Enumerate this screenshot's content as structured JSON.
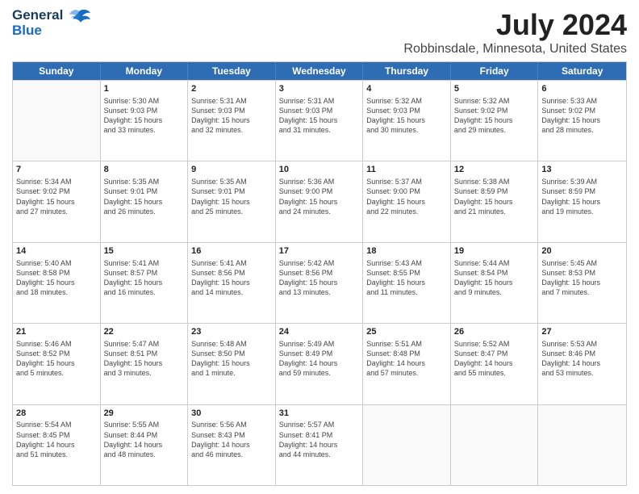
{
  "header": {
    "logo_line1": "General",
    "logo_line2": "Blue",
    "title": "July 2024",
    "location": "Robbinsdale, Minnesota, United States"
  },
  "days_of_week": [
    "Sunday",
    "Monday",
    "Tuesday",
    "Wednesday",
    "Thursday",
    "Friday",
    "Saturday"
  ],
  "weeks": [
    [
      {
        "day": "",
        "empty": true
      },
      {
        "day": "1",
        "sunrise": "Sunrise: 5:30 AM",
        "sunset": "Sunset: 9:03 PM",
        "daylight": "Daylight: 15 hours",
        "daylight2": "and 33 minutes."
      },
      {
        "day": "2",
        "sunrise": "Sunrise: 5:31 AM",
        "sunset": "Sunset: 9:03 PM",
        "daylight": "Daylight: 15 hours",
        "daylight2": "and 32 minutes."
      },
      {
        "day": "3",
        "sunrise": "Sunrise: 5:31 AM",
        "sunset": "Sunset: 9:03 PM",
        "daylight": "Daylight: 15 hours",
        "daylight2": "and 31 minutes."
      },
      {
        "day": "4",
        "sunrise": "Sunrise: 5:32 AM",
        "sunset": "Sunset: 9:03 PM",
        "daylight": "Daylight: 15 hours",
        "daylight2": "and 30 minutes."
      },
      {
        "day": "5",
        "sunrise": "Sunrise: 5:32 AM",
        "sunset": "Sunset: 9:02 PM",
        "daylight": "Daylight: 15 hours",
        "daylight2": "and 29 minutes."
      },
      {
        "day": "6",
        "sunrise": "Sunrise: 5:33 AM",
        "sunset": "Sunset: 9:02 PM",
        "daylight": "Daylight: 15 hours",
        "daylight2": "and 28 minutes."
      }
    ],
    [
      {
        "day": "7",
        "sunrise": "Sunrise: 5:34 AM",
        "sunset": "Sunset: 9:02 PM",
        "daylight": "Daylight: 15 hours",
        "daylight2": "and 27 minutes."
      },
      {
        "day": "8",
        "sunrise": "Sunrise: 5:35 AM",
        "sunset": "Sunset: 9:01 PM",
        "daylight": "Daylight: 15 hours",
        "daylight2": "and 26 minutes."
      },
      {
        "day": "9",
        "sunrise": "Sunrise: 5:35 AM",
        "sunset": "Sunset: 9:01 PM",
        "daylight": "Daylight: 15 hours",
        "daylight2": "and 25 minutes."
      },
      {
        "day": "10",
        "sunrise": "Sunrise: 5:36 AM",
        "sunset": "Sunset: 9:00 PM",
        "daylight": "Daylight: 15 hours",
        "daylight2": "and 24 minutes."
      },
      {
        "day": "11",
        "sunrise": "Sunrise: 5:37 AM",
        "sunset": "Sunset: 9:00 PM",
        "daylight": "Daylight: 15 hours",
        "daylight2": "and 22 minutes."
      },
      {
        "day": "12",
        "sunrise": "Sunrise: 5:38 AM",
        "sunset": "Sunset: 8:59 PM",
        "daylight": "Daylight: 15 hours",
        "daylight2": "and 21 minutes."
      },
      {
        "day": "13",
        "sunrise": "Sunrise: 5:39 AM",
        "sunset": "Sunset: 8:59 PM",
        "daylight": "Daylight: 15 hours",
        "daylight2": "and 19 minutes."
      }
    ],
    [
      {
        "day": "14",
        "sunrise": "Sunrise: 5:40 AM",
        "sunset": "Sunset: 8:58 PM",
        "daylight": "Daylight: 15 hours",
        "daylight2": "and 18 minutes."
      },
      {
        "day": "15",
        "sunrise": "Sunrise: 5:41 AM",
        "sunset": "Sunset: 8:57 PM",
        "daylight": "Daylight: 15 hours",
        "daylight2": "and 16 minutes."
      },
      {
        "day": "16",
        "sunrise": "Sunrise: 5:41 AM",
        "sunset": "Sunset: 8:56 PM",
        "daylight": "Daylight: 15 hours",
        "daylight2": "and 14 minutes."
      },
      {
        "day": "17",
        "sunrise": "Sunrise: 5:42 AM",
        "sunset": "Sunset: 8:56 PM",
        "daylight": "Daylight: 15 hours",
        "daylight2": "and 13 minutes."
      },
      {
        "day": "18",
        "sunrise": "Sunrise: 5:43 AM",
        "sunset": "Sunset: 8:55 PM",
        "daylight": "Daylight: 15 hours",
        "daylight2": "and 11 minutes."
      },
      {
        "day": "19",
        "sunrise": "Sunrise: 5:44 AM",
        "sunset": "Sunset: 8:54 PM",
        "daylight": "Daylight: 15 hours",
        "daylight2": "and 9 minutes."
      },
      {
        "day": "20",
        "sunrise": "Sunrise: 5:45 AM",
        "sunset": "Sunset: 8:53 PM",
        "daylight": "Daylight: 15 hours",
        "daylight2": "and 7 minutes."
      }
    ],
    [
      {
        "day": "21",
        "sunrise": "Sunrise: 5:46 AM",
        "sunset": "Sunset: 8:52 PM",
        "daylight": "Daylight: 15 hours",
        "daylight2": "and 5 minutes."
      },
      {
        "day": "22",
        "sunrise": "Sunrise: 5:47 AM",
        "sunset": "Sunset: 8:51 PM",
        "daylight": "Daylight: 15 hours",
        "daylight2": "and 3 minutes."
      },
      {
        "day": "23",
        "sunrise": "Sunrise: 5:48 AM",
        "sunset": "Sunset: 8:50 PM",
        "daylight": "Daylight: 15 hours",
        "daylight2": "and 1 minute."
      },
      {
        "day": "24",
        "sunrise": "Sunrise: 5:49 AM",
        "sunset": "Sunset: 8:49 PM",
        "daylight": "Daylight: 14 hours",
        "daylight2": "and 59 minutes."
      },
      {
        "day": "25",
        "sunrise": "Sunrise: 5:51 AM",
        "sunset": "Sunset: 8:48 PM",
        "daylight": "Daylight: 14 hours",
        "daylight2": "and 57 minutes."
      },
      {
        "day": "26",
        "sunrise": "Sunrise: 5:52 AM",
        "sunset": "Sunset: 8:47 PM",
        "daylight": "Daylight: 14 hours",
        "daylight2": "and 55 minutes."
      },
      {
        "day": "27",
        "sunrise": "Sunrise: 5:53 AM",
        "sunset": "Sunset: 8:46 PM",
        "daylight": "Daylight: 14 hours",
        "daylight2": "and 53 minutes."
      }
    ],
    [
      {
        "day": "28",
        "sunrise": "Sunrise: 5:54 AM",
        "sunset": "Sunset: 8:45 PM",
        "daylight": "Daylight: 14 hours",
        "daylight2": "and 51 minutes."
      },
      {
        "day": "29",
        "sunrise": "Sunrise: 5:55 AM",
        "sunset": "Sunset: 8:44 PM",
        "daylight": "Daylight: 14 hours",
        "daylight2": "and 48 minutes."
      },
      {
        "day": "30",
        "sunrise": "Sunrise: 5:56 AM",
        "sunset": "Sunset: 8:43 PM",
        "daylight": "Daylight: 14 hours",
        "daylight2": "and 46 minutes."
      },
      {
        "day": "31",
        "sunrise": "Sunrise: 5:57 AM",
        "sunset": "Sunset: 8:41 PM",
        "daylight": "Daylight: 14 hours",
        "daylight2": "and 44 minutes."
      },
      {
        "day": "",
        "empty": true
      },
      {
        "day": "",
        "empty": true
      },
      {
        "day": "",
        "empty": true
      }
    ]
  ]
}
